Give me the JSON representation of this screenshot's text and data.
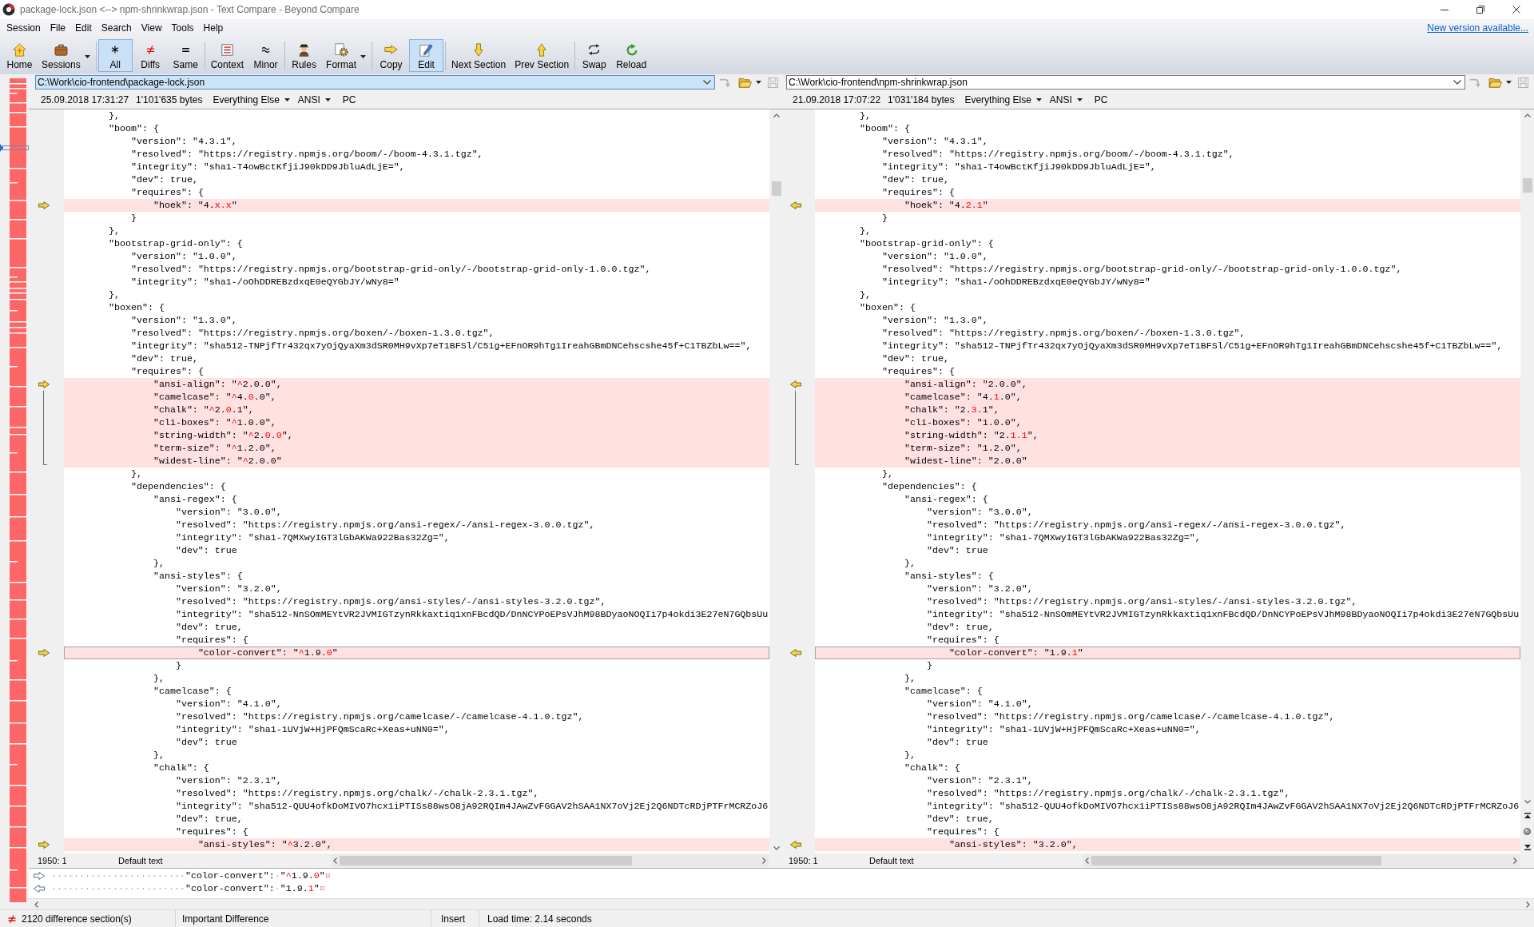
{
  "window": {
    "title": "package-lock.json <--> npm-shrinkwrap.json - Text Compare - Beyond Compare"
  },
  "menu": [
    "Session",
    "File",
    "Edit",
    "Search",
    "View",
    "Tools",
    "Help"
  ],
  "update_link": "New version available...",
  "toolbar": [
    {
      "buttons": [
        {
          "label": "Home",
          "selected": false,
          "dropdown": false
        },
        {
          "label": "Sessions",
          "selected": false,
          "dropdown": true
        }
      ]
    },
    {
      "buttons": [
        {
          "label": "All",
          "selected": true,
          "dropdown": false
        },
        {
          "label": "Diffs",
          "selected": false,
          "dropdown": false
        },
        {
          "label": "Same",
          "selected": false,
          "dropdown": false
        }
      ]
    },
    {
      "buttons": [
        {
          "label": "Context",
          "selected": false,
          "dropdown": false
        },
        {
          "label": "Minor",
          "selected": false,
          "dropdown": false
        }
      ]
    },
    {
      "buttons": [
        {
          "label": "Rules",
          "selected": false,
          "dropdown": false
        },
        {
          "label": "Format",
          "selected": false,
          "dropdown": true
        }
      ]
    },
    {
      "buttons": [
        {
          "label": "Copy",
          "selected": false,
          "dropdown": false
        },
        {
          "label": "Edit",
          "selected": true,
          "dropdown": false
        }
      ]
    },
    {
      "buttons": [
        {
          "label": "Next Section",
          "selected": false,
          "dropdown": false
        },
        {
          "label": "Prev Section",
          "selected": false,
          "dropdown": false
        }
      ]
    },
    {
      "buttons": [
        {
          "label": "Swap",
          "selected": false,
          "dropdown": false
        },
        {
          "label": "Reload",
          "selected": false,
          "dropdown": false
        }
      ]
    }
  ],
  "files": [
    {
      "path": "C:\\Work\\cio-frontend\\package-lock.json",
      "focused": true,
      "arrow_enabled": false,
      "save_enabled": false,
      "modified": "25.09.2018 17:31:27",
      "size": "1'101'635 bytes",
      "filter": "Everything Else",
      "encoding": "ANSI",
      "line_endings": "PC",
      "cursor": "1950: 1",
      "text_format": "Default text",
      "lines": [
        {
          "text": "        },",
          "differs": false,
          "selected": false
        },
        {
          "text": "        \"boom\": {",
          "differs": false,
          "selected": false
        },
        {
          "text": "            \"version\": \"4.3.1\",",
          "differs": false,
          "selected": false
        },
        {
          "text": "            \"resolved\": \"https://registry.npmjs.org/boom/-/boom-4.3.1.tgz\",",
          "differs": false,
          "selected": false
        },
        {
          "text": "            \"integrity\": \"sha1-T4owBctKfjiJ90kDD9JbluAdLjE=\",",
          "differs": false,
          "selected": false
        },
        {
          "text": "            \"dev\": true,",
          "differs": false,
          "selected": false
        },
        {
          "text": "            \"requires\": {",
          "differs": false,
          "selected": false
        },
        {
          "parts": [
            {
              "text": "                \"hoek\": \"4.",
              "kind": "same"
            },
            {
              "text": "x.x",
              "kind": "changed"
            },
            {
              "text": "\"",
              "kind": "same"
            }
          ],
          "differs": true,
          "selected": false
        },
        {
          "text": "            }",
          "differs": false,
          "selected": false
        },
        {
          "text": "        },",
          "differs": false,
          "selected": false
        },
        {
          "text": "        \"bootstrap-grid-only\": {",
          "differs": false,
          "selected": false
        },
        {
          "text": "            \"version\": \"1.0.0\",",
          "differs": false,
          "selected": false
        },
        {
          "text": "            \"resolved\": \"https://registry.npmjs.org/bootstrap-grid-only/-/bootstrap-grid-only-1.0.0.tgz\",",
          "differs": false,
          "selected": false
        },
        {
          "text": "            \"integrity\": \"sha1-/oOhDDREBzdxqE0eQYGbJY/wNy8=\"",
          "differs": false,
          "selected": false
        },
        {
          "text": "        },",
          "differs": false,
          "selected": false
        },
        {
          "text": "        \"boxen\": {",
          "differs": false,
          "selected": false
        },
        {
          "text": "            \"version\": \"1.3.0\",",
          "differs": false,
          "selected": false
        },
        {
          "text": "            \"resolved\": \"https://registry.npmjs.org/boxen/-/boxen-1.3.0.tgz\",",
          "differs": false,
          "selected": false
        },
        {
          "text": "            \"integrity\": \"sha512-TNPjfTr432qx7yOjQyaXm3dSR0MH9vXp7eT1BFSl/C51g+EFnOR9hTg1IreahGBmDNCehscshe45f+C1TBZbLw==\",",
          "differs": false,
          "selected": false
        },
        {
          "text": "            \"dev\": true,",
          "differs": false,
          "selected": false
        },
        {
          "text": "            \"requires\": {",
          "differs": false,
          "selected": false
        },
        {
          "parts": [
            {
              "text": "                \"ansi-align\": \"",
              "kind": "same"
            },
            {
              "text": "^",
              "kind": "changed"
            },
            {
              "text": "2.0.0\",",
              "kind": "same"
            }
          ],
          "differs": true,
          "selected": false
        },
        {
          "parts": [
            {
              "text": "                \"camelcase\": \"",
              "kind": "same"
            },
            {
              "text": "^",
              "kind": "changed"
            },
            {
              "text": "4.",
              "kind": "same"
            },
            {
              "text": "0",
              "kind": "changed"
            },
            {
              "text": ".0\",",
              "kind": "same"
            }
          ],
          "differs": true,
          "selected": false
        },
        {
          "parts": [
            {
              "text": "                \"chalk\": \"",
              "kind": "same"
            },
            {
              "text": "^",
              "kind": "changed"
            },
            {
              "text": "2.",
              "kind": "same"
            },
            {
              "text": "0",
              "kind": "changed"
            },
            {
              "text": ".1\",",
              "kind": "same"
            }
          ],
          "differs": true,
          "selected": false
        },
        {
          "parts": [
            {
              "text": "                \"cli-boxes\": \"",
              "kind": "same"
            },
            {
              "text": "^",
              "kind": "changed"
            },
            {
              "text": "1.0.0\",",
              "kind": "same"
            }
          ],
          "differs": true,
          "selected": false
        },
        {
          "parts": [
            {
              "text": "                \"string-width\": \"",
              "kind": "same"
            },
            {
              "text": "^",
              "kind": "changed"
            },
            {
              "text": "2.",
              "kind": "same"
            },
            {
              "text": "0.0",
              "kind": "changed"
            },
            {
              "text": "\",",
              "kind": "same"
            }
          ],
          "differs": true,
          "selected": false
        },
        {
          "parts": [
            {
              "text": "                \"term-size\": \"",
              "kind": "same"
            },
            {
              "text": "^",
              "kind": "changed"
            },
            {
              "text": "1.2.0\",",
              "kind": "same"
            }
          ],
          "differs": true,
          "selected": false
        },
        {
          "parts": [
            {
              "text": "                \"widest-line\": \"",
              "kind": "same"
            },
            {
              "text": "^",
              "kind": "changed"
            },
            {
              "text": "2.0.0\"",
              "kind": "same"
            }
          ],
          "differs": true,
          "selected": false
        },
        {
          "text": "            },",
          "differs": false,
          "selected": false
        },
        {
          "text": "            \"dependencies\": {",
          "differs": false,
          "selected": false
        },
        {
          "text": "                \"ansi-regex\": {",
          "differs": false,
          "selected": false
        },
        {
          "text": "                    \"version\": \"3.0.0\",",
          "differs": false,
          "selected": false
        },
        {
          "text": "                    \"resolved\": \"https://registry.npmjs.org/ansi-regex/-/ansi-regex-3.0.0.tgz\",",
          "differs": false,
          "selected": false
        },
        {
          "text": "                    \"integrity\": \"sha1-7QMXwyIGT3lGbAKWa922Bas32Zg=\",",
          "differs": false,
          "selected": false
        },
        {
          "text": "                    \"dev\": true",
          "differs": false,
          "selected": false
        },
        {
          "text": "                },",
          "differs": false,
          "selected": false
        },
        {
          "text": "                \"ansi-styles\": {",
          "differs": false,
          "selected": false
        },
        {
          "text": "                    \"version\": \"3.2.0\",",
          "differs": false,
          "selected": false
        },
        {
          "text": "                    \"resolved\": \"https://registry.npmjs.org/ansi-styles/-/ansi-styles-3.2.0.tgz\",",
          "differs": false,
          "selected": false
        },
        {
          "text": "                    \"integrity\": \"sha512-NnSOmMEYtVR2JVMIGTzynRkkaxtiq1xnFBcdQD/DnNCYPoEPsVJhM98BDyaoNOQIi7p4okdi3E27eN7GQbsUu",
          "differs": false,
          "selected": false
        },
        {
          "text": "                    \"dev\": true,",
          "differs": false,
          "selected": false
        },
        {
          "text": "                    \"requires\": {",
          "differs": false,
          "selected": false
        },
        {
          "parts": [
            {
              "text": "                        \"color-convert\": \"",
              "kind": "same"
            },
            {
              "text": "^",
              "kind": "changed"
            },
            {
              "text": "1.9.",
              "kind": "same"
            },
            {
              "text": "0",
              "kind": "changed"
            },
            {
              "text": "\"",
              "kind": "same"
            }
          ],
          "differs": true,
          "selected": true
        },
        {
          "text": "                    }",
          "differs": false,
          "selected": false
        },
        {
          "text": "                },",
          "differs": false,
          "selected": false
        },
        {
          "text": "                \"camelcase\": {",
          "differs": false,
          "selected": false
        },
        {
          "text": "                    \"version\": \"4.1.0\",",
          "differs": false,
          "selected": false
        },
        {
          "text": "                    \"resolved\": \"https://registry.npmjs.org/camelcase/-/camelcase-4.1.0.tgz\",",
          "differs": false,
          "selected": false
        },
        {
          "text": "                    \"integrity\": \"sha1-1UVjW+HjPFQmScaRc+Xeas+uNN0=\",",
          "differs": false,
          "selected": false
        },
        {
          "text": "                    \"dev\": true",
          "differs": false,
          "selected": false
        },
        {
          "text": "                },",
          "differs": false,
          "selected": false
        },
        {
          "text": "                \"chalk\": {",
          "differs": false,
          "selected": false
        },
        {
          "text": "                    \"version\": \"2.3.1\",",
          "differs": false,
          "selected": false
        },
        {
          "text": "                    \"resolved\": \"https://registry.npmjs.org/chalk/-/chalk-2.3.1.tgz\",",
          "differs": false,
          "selected": false
        },
        {
          "text": "                    \"integrity\": \"sha512-QUU4ofkDoMIVO7hcx1iPTISs88wsO8jA92RQIm4JAwZvFGGAV2hSAA1NX7oVj2Ej2Q6NDTcRDjPTFrMCRZoJ6",
          "differs": false,
          "selected": false
        },
        {
          "text": "                    \"dev\": true,",
          "differs": false,
          "selected": false
        },
        {
          "text": "                    \"requires\": {",
          "differs": false,
          "selected": false
        },
        {
          "parts": [
            {
              "text": "                        \"ansi-styles\": \"",
              "kind": "same"
            },
            {
              "text": "^",
              "kind": "changed"
            },
            {
              "text": "3.2.0\",",
              "kind": "same"
            }
          ],
          "differs": true,
          "selected": false
        }
      ]
    },
    {
      "path": "C:\\Work\\cio-frontend\\npm-shrinkwrap.json",
      "focused": false,
      "arrow_enabled": false,
      "save_enabled": false,
      "modified": "21.09.2018 17:07:22",
      "size": "1'031'184 bytes",
      "filter": "Everything Else",
      "encoding": "ANSI",
      "line_endings": "PC",
      "cursor": "1950: 1",
      "text_format": "Default text",
      "lines": [
        {
          "text": "        },",
          "differs": false,
          "selected": false
        },
        {
          "text": "        \"boom\": {",
          "differs": false,
          "selected": false
        },
        {
          "text": "            \"version\": \"4.3.1\",",
          "differs": false,
          "selected": false
        },
        {
          "text": "            \"resolved\": \"https://registry.npmjs.org/boom/-/boom-4.3.1.tgz\",",
          "differs": false,
          "selected": false
        },
        {
          "text": "            \"integrity\": \"sha1-T4owBctKfjiJ90kDD9JbluAdLjE=\",",
          "differs": false,
          "selected": false
        },
        {
          "text": "            \"dev\": true,",
          "differs": false,
          "selected": false
        },
        {
          "text": "            \"requires\": {",
          "differs": false,
          "selected": false
        },
        {
          "parts": [
            {
              "text": "                \"hoek\": \"4.",
              "kind": "same"
            },
            {
              "text": "2.1",
              "kind": "changed"
            },
            {
              "text": "\"",
              "kind": "same"
            }
          ],
          "differs": true,
          "selected": false
        },
        {
          "text": "            }",
          "differs": false,
          "selected": false
        },
        {
          "text": "        },",
          "differs": false,
          "selected": false
        },
        {
          "text": "        \"bootstrap-grid-only\": {",
          "differs": false,
          "selected": false
        },
        {
          "text": "            \"version\": \"1.0.0\",",
          "differs": false,
          "selected": false
        },
        {
          "text": "            \"resolved\": \"https://registry.npmjs.org/bootstrap-grid-only/-/bootstrap-grid-only-1.0.0.tgz\",",
          "differs": false,
          "selected": false
        },
        {
          "text": "            \"integrity\": \"sha1-/oOhDDREBzdxqE0eQYGbJY/wNy8=\"",
          "differs": false,
          "selected": false
        },
        {
          "text": "        },",
          "differs": false,
          "selected": false
        },
        {
          "text": "        \"boxen\": {",
          "differs": false,
          "selected": false
        },
        {
          "text": "            \"version\": \"1.3.0\",",
          "differs": false,
          "selected": false
        },
        {
          "text": "            \"resolved\": \"https://registry.npmjs.org/boxen/-/boxen-1.3.0.tgz\",",
          "differs": false,
          "selected": false
        },
        {
          "text": "            \"integrity\": \"sha512-TNPjfTr432qx7yOjQyaXm3dSR0MH9vXp7eT1BFSl/C51g+EFnOR9hTg1IreahGBmDNCehscshe45f+C1TBZbLw==\",",
          "differs": false,
          "selected": false
        },
        {
          "text": "            \"dev\": true,",
          "differs": false,
          "selected": false
        },
        {
          "text": "            \"requires\": {",
          "differs": false,
          "selected": false
        },
        {
          "text": "                \"ansi-align\": \"2.0.0\",",
          "differs": true,
          "selected": false
        },
        {
          "parts": [
            {
              "text": "                \"camelcase\": \"4.",
              "kind": "same"
            },
            {
              "text": "1",
              "kind": "changed"
            },
            {
              "text": ".0\",",
              "kind": "same"
            }
          ],
          "differs": true,
          "selected": false
        },
        {
          "parts": [
            {
              "text": "                \"chalk\": \"2.",
              "kind": "same"
            },
            {
              "text": "3",
              "kind": "changed"
            },
            {
              "text": ".1\",",
              "kind": "same"
            }
          ],
          "differs": true,
          "selected": false
        },
        {
          "text": "                \"cli-boxes\": \"1.0.0\",",
          "differs": true,
          "selected": false
        },
        {
          "parts": [
            {
              "text": "                \"string-width\": \"2.",
              "kind": "same"
            },
            {
              "text": "1.1",
              "kind": "changed"
            },
            {
              "text": "\",",
              "kind": "same"
            }
          ],
          "differs": true,
          "selected": false
        },
        {
          "text": "                \"term-size\": \"1.2.0\",",
          "differs": true,
          "selected": false
        },
        {
          "text": "                \"widest-line\": \"2.0.0\"",
          "differs": true,
          "selected": false
        },
        {
          "text": "            },",
          "differs": false,
          "selected": false
        },
        {
          "text": "            \"dependencies\": {",
          "differs": false,
          "selected": false
        },
        {
          "text": "                \"ansi-regex\": {",
          "differs": false,
          "selected": false
        },
        {
          "text": "                    \"version\": \"3.0.0\",",
          "differs": false,
          "selected": false
        },
        {
          "text": "                    \"resolved\": \"https://registry.npmjs.org/ansi-regex/-/ansi-regex-3.0.0.tgz\",",
          "differs": false,
          "selected": false
        },
        {
          "text": "                    \"integrity\": \"sha1-7QMXwyIGT3lGbAKWa922Bas32Zg=\",",
          "differs": false,
          "selected": false
        },
        {
          "text": "                    \"dev\": true",
          "differs": false,
          "selected": false
        },
        {
          "text": "                },",
          "differs": false,
          "selected": false
        },
        {
          "text": "                \"ansi-styles\": {",
          "differs": false,
          "selected": false
        },
        {
          "text": "                    \"version\": \"3.2.0\",",
          "differs": false,
          "selected": false
        },
        {
          "text": "                    \"resolved\": \"https://registry.npmjs.org/ansi-styles/-/ansi-styles-3.2.0.tgz\",",
          "differs": false,
          "selected": false
        },
        {
          "text": "                    \"integrity\": \"sha512-NnSOmMEYtVR2JVMIGTzynRkkaxtiq1xnFBcdQD/DnNCYPoEPsVJhM98BDyaoNOQIi7p4okdi3E27eN7GQbsUu",
          "differs": false,
          "selected": false
        },
        {
          "text": "                    \"dev\": true,",
          "differs": false,
          "selected": false
        },
        {
          "text": "                    \"requires\": {",
          "differs": false,
          "selected": false
        },
        {
          "parts": [
            {
              "text": "                        \"color-convert\": \"1.9.",
              "kind": "same"
            },
            {
              "text": "1",
              "kind": "changed"
            },
            {
              "text": "\"",
              "kind": "same"
            }
          ],
          "differs": true,
          "selected": true
        },
        {
          "text": "                    }",
          "differs": false,
          "selected": false
        },
        {
          "text": "                },",
          "differs": false,
          "selected": false
        },
        {
          "text": "                \"camelcase\": {",
          "differs": false,
          "selected": false
        },
        {
          "text": "                    \"version\": \"4.1.0\",",
          "differs": false,
          "selected": false
        },
        {
          "text": "                    \"resolved\": \"https://registry.npmjs.org/camelcase/-/camelcase-4.1.0.tgz\",",
          "differs": false,
          "selected": false
        },
        {
          "text": "                    \"integrity\": \"sha1-1UVjW+HjPFQmScaRc+Xeas+uNN0=\",",
          "differs": false,
          "selected": false
        },
        {
          "text": "                    \"dev\": true",
          "differs": false,
          "selected": false
        },
        {
          "text": "                },",
          "differs": false,
          "selected": false
        },
        {
          "text": "                \"chalk\": {",
          "differs": false,
          "selected": false
        },
        {
          "text": "                    \"version\": \"2.3.1\",",
          "differs": false,
          "selected": false
        },
        {
          "text": "                    \"resolved\": \"https://registry.npmjs.org/chalk/-/chalk-2.3.1.tgz\",",
          "differs": false,
          "selected": false
        },
        {
          "text": "                    \"integrity\": \"sha512-QUU4ofkDoMIVO7hcx1iPTISs88wsO8jA92RQIm4JAwZvFGGAV2hSAA1NX7oVj2Ej2Q6NDTcRDjPTFrMCRZoJ6",
          "differs": false,
          "selected": false
        },
        {
          "text": "                    \"dev\": true,",
          "differs": false,
          "selected": false
        },
        {
          "text": "                    \"requires\": {",
          "differs": false,
          "selected": false
        },
        {
          "text": "                        \"ansi-styles\": \"3.2.0\",",
          "differs": true,
          "selected": false
        }
      ]
    }
  ],
  "line_details": [
    {
      "kind": "left",
      "parts": [
        {
          "text": "························",
          "kind": "whitespace"
        },
        {
          "text": "\"color-convert\":",
          "kind": "same"
        },
        {
          "text": "·",
          "kind": "whitespace"
        },
        {
          "text": "\"",
          "kind": "same"
        },
        {
          "text": "^",
          "kind": "changed"
        },
        {
          "text": "1.9.",
          "kind": "same"
        },
        {
          "text": "0",
          "kind": "changed"
        },
        {
          "text": "\"",
          "kind": "same"
        },
        {
          "text": "¤",
          "kind": "whitespace"
        }
      ]
    },
    {
      "kind": "right",
      "parts": [
        {
          "text": "························",
          "kind": "whitespace"
        },
        {
          "text": "\"color-convert\":",
          "kind": "same"
        },
        {
          "text": "·",
          "kind": "whitespace"
        },
        {
          "text": "\"1.9.",
          "kind": "same"
        },
        {
          "text": "1",
          "kind": "changed"
        },
        {
          "text": "\"",
          "kind": "same"
        },
        {
          "text": "¤",
          "kind": "whitespace"
        }
      ]
    }
  ],
  "status_bar": {
    "differences": "2120 difference section(s)",
    "importance": "Important Difference",
    "mode": "Insert",
    "load_time": "Load time: 2.14 seconds"
  }
}
